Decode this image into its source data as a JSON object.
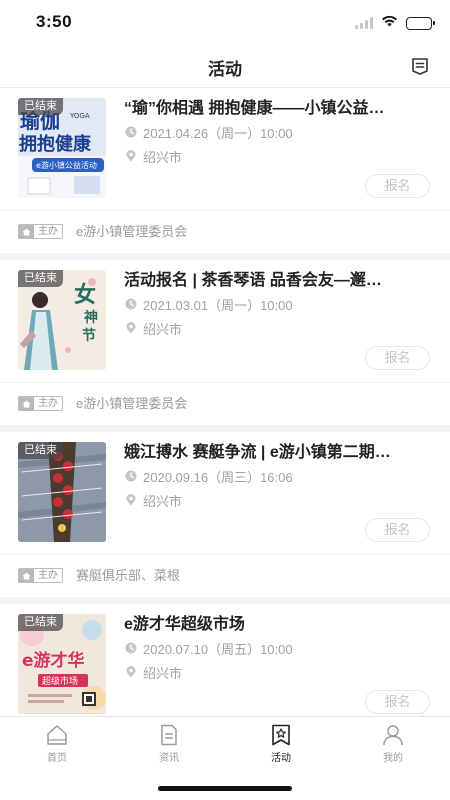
{
  "status_bar": {
    "time": "3:50"
  },
  "header": {
    "title": "活动",
    "action_icon": "filter-icon"
  },
  "events": [
    {
      "ended_label": "已结束",
      "title": "“瑜”你相遇 拥抱健康——小镇公益…",
      "time": "2021.04.26（周一）10:00",
      "location": "绍兴市",
      "signup_label": "报名",
      "host_label": "主办",
      "host": "e游小镇管理委员会",
      "poster": {
        "lines": [
          "瑜伽",
          "YOGA",
          "拥抱健康",
          "e游小镇公益活动"
        ],
        "colors": [
          "#dfe7f3",
          "#1b3f8f"
        ]
      }
    },
    {
      "ended_label": "已结束",
      "title": "活动报名 | 茶香琴语 品香会友—邂…",
      "time": "2021.03.01（周一）10:00",
      "location": "绍兴市",
      "signup_label": "报名",
      "host_label": "主办",
      "host": "e游小镇管理委员会",
      "poster": {
        "lines": [
          "女",
          "神",
          "节"
        ],
        "colors": [
          "#efe8df",
          "#2c6a5c"
        ]
      }
    },
    {
      "ended_label": "已结束",
      "title": "娥江搏水 赛艇争流 | e游小镇第二期…",
      "time": "2020.09.16（周三）16:06",
      "location": "绍兴市",
      "signup_label": "报名",
      "host_label": "主办",
      "host": "赛艇俱乐部、菜根",
      "poster": {
        "lines": [],
        "colors": [
          "#8a95a6",
          "#c62f2f"
        ]
      }
    },
    {
      "ended_label": "已结束",
      "title": "e游才华超级市场",
      "time": "2020.07.10（周五）10:00",
      "location": "绍兴市",
      "signup_label": "报名",
      "host_label": "主办",
      "host": "",
      "poster": {
        "lines": [
          "e游才华",
          "超级市场"
        ],
        "colors": [
          "#f1e6dc",
          "#d9325a"
        ]
      }
    }
  ],
  "tabbar": {
    "active": "活动",
    "tabs": [
      {
        "label": "首页",
        "icon": "home-icon"
      },
      {
        "label": "资讯",
        "icon": "news-icon"
      },
      {
        "label": "活动",
        "icon": "activity-icon"
      },
      {
        "label": "我的",
        "icon": "profile-icon"
      }
    ]
  }
}
